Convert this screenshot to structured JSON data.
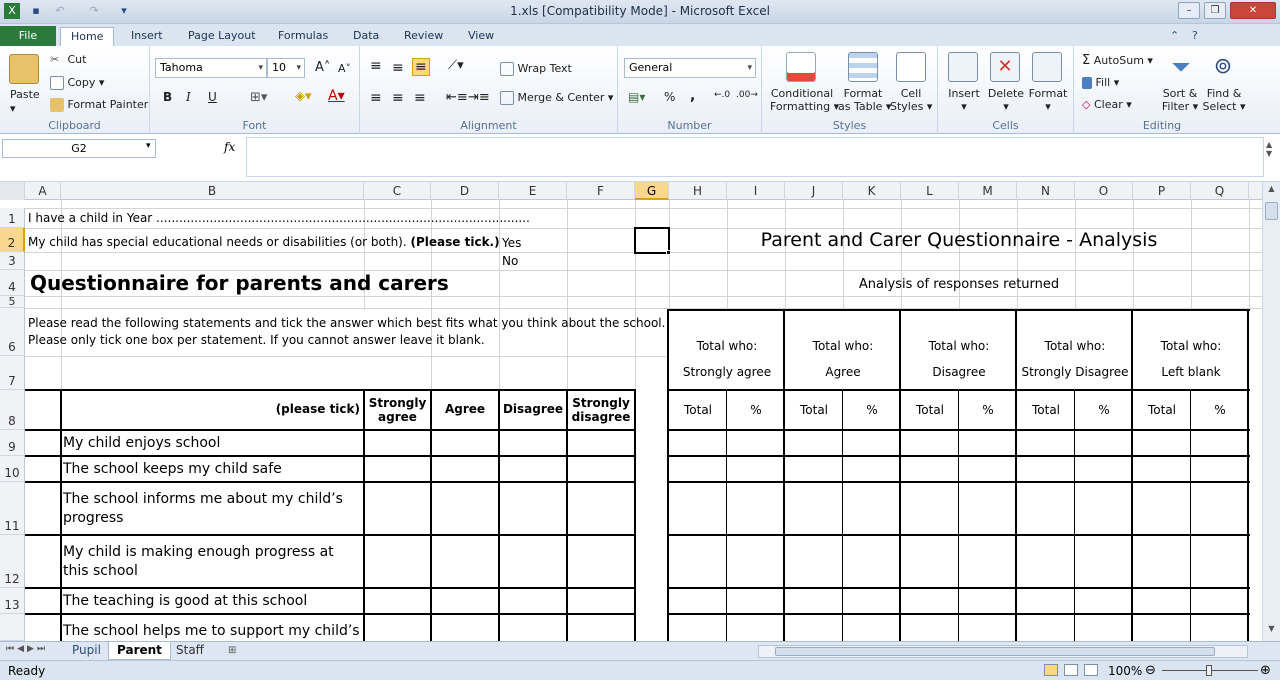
{
  "window": {
    "title": "1.xls  [Compatibility Mode]  -  Microsoft Excel"
  },
  "tabs": [
    "File",
    "Home",
    "Insert",
    "Page Layout",
    "Formulas",
    "Data",
    "Review",
    "View"
  ],
  "ribbon": {
    "clipboard": {
      "paste": "Paste",
      "cut": "Cut",
      "copy": "Copy",
      "format_painter": "Format Painter",
      "label": "Clipboard"
    },
    "font": {
      "name": "Tahoma",
      "size": "10",
      "label": "Font",
      "bold": "B",
      "italic": "I",
      "underline": "U"
    },
    "alignment": {
      "wrap": "Wrap Text",
      "merge": "Merge & Center",
      "label": "Alignment"
    },
    "number": {
      "format": "General",
      "percent": "%",
      "comma": ",",
      "label": "Number"
    },
    "styles": {
      "cond1": "Conditional",
      "cond2": "Formatting",
      "fmt1": "Format",
      "fmt2": "as Table",
      "cell1": "Cell",
      "cell2": "Styles",
      "label": "Styles"
    },
    "cells": {
      "insert": "Insert",
      "delete": "Delete",
      "format": "Format",
      "label": "Cells"
    },
    "editing": {
      "autosum": "AutoSum",
      "fill": "Fill",
      "clear": "Clear",
      "sort1": "Sort &",
      "sort2": "Filter",
      "find1": "Find &",
      "find2": "Select",
      "label": "Editing"
    }
  },
  "formula_bar": {
    "name_box": "G2",
    "fx": "fx",
    "value": ""
  },
  "columns": [
    "A",
    "B",
    "C",
    "D",
    "E",
    "F",
    "G",
    "H",
    "I",
    "J",
    "K",
    "L",
    "M",
    "N",
    "O",
    "P",
    "Q"
  ],
  "rows": [
    "1",
    "2",
    "3",
    "4",
    "5",
    "6",
    "7",
    "8",
    "9",
    "10",
    "11",
    "12",
    "13",
    ""
  ],
  "sheet": {
    "r1": "I have a child in Year ..................................................................................................",
    "r2": "My child has special educational needs or disabilities (or both).",
    "r2_bold": "(Please tick.)",
    "yes": "Yes",
    "no": "No",
    "heading": "Questionnaire for parents and carers",
    "instr1": "Please read the following statements and tick the answer which best fits what you think about the school.",
    "instr2": "Please only tick one box per statement. If you cannot answer leave it blank.",
    "please_tick": "(please tick)",
    "hdr": [
      "Strongly agree",
      "Agree",
      "Disagree",
      "Strongly disagree"
    ],
    "statements": [
      "My child enjoys school",
      "The school keeps my child safe",
      "The school informs me about my child’s progress",
      "My child is making enough progress at this school",
      "The teaching is good at this school",
      "The school helps me to support my child’s"
    ],
    "analysis_title": "Parent and Carer Questionnaire - Analysis",
    "analysis_sub": "Analysis of responses returned",
    "total_who": "Total who:",
    "groups": [
      "Strongly agree",
      "Agree",
      "Disagree",
      "Strongly Disagree",
      "Left blank"
    ],
    "total": "Total",
    "pct": "%"
  },
  "sheet_tabs": [
    "Pupil",
    "Parent",
    "Staff"
  ],
  "status": {
    "ready": "Ready",
    "zoom": "100%"
  }
}
